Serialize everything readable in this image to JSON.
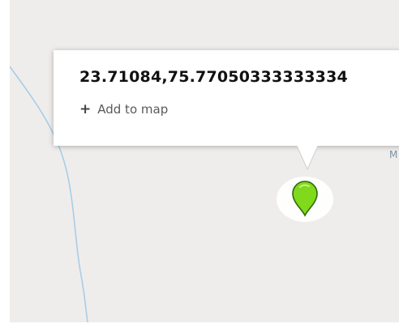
{
  "popup": {
    "coordinates": "23.71084,75.77050333333334",
    "add_to_map": {
      "icon": "plus-icon",
      "label": "Add to map"
    }
  },
  "map": {
    "edge_label": "M",
    "marker": {
      "icon": "map-pin-icon",
      "color": "#7fd81a"
    },
    "river_color": "#9ec9e8",
    "background_color": "#efedeb"
  }
}
